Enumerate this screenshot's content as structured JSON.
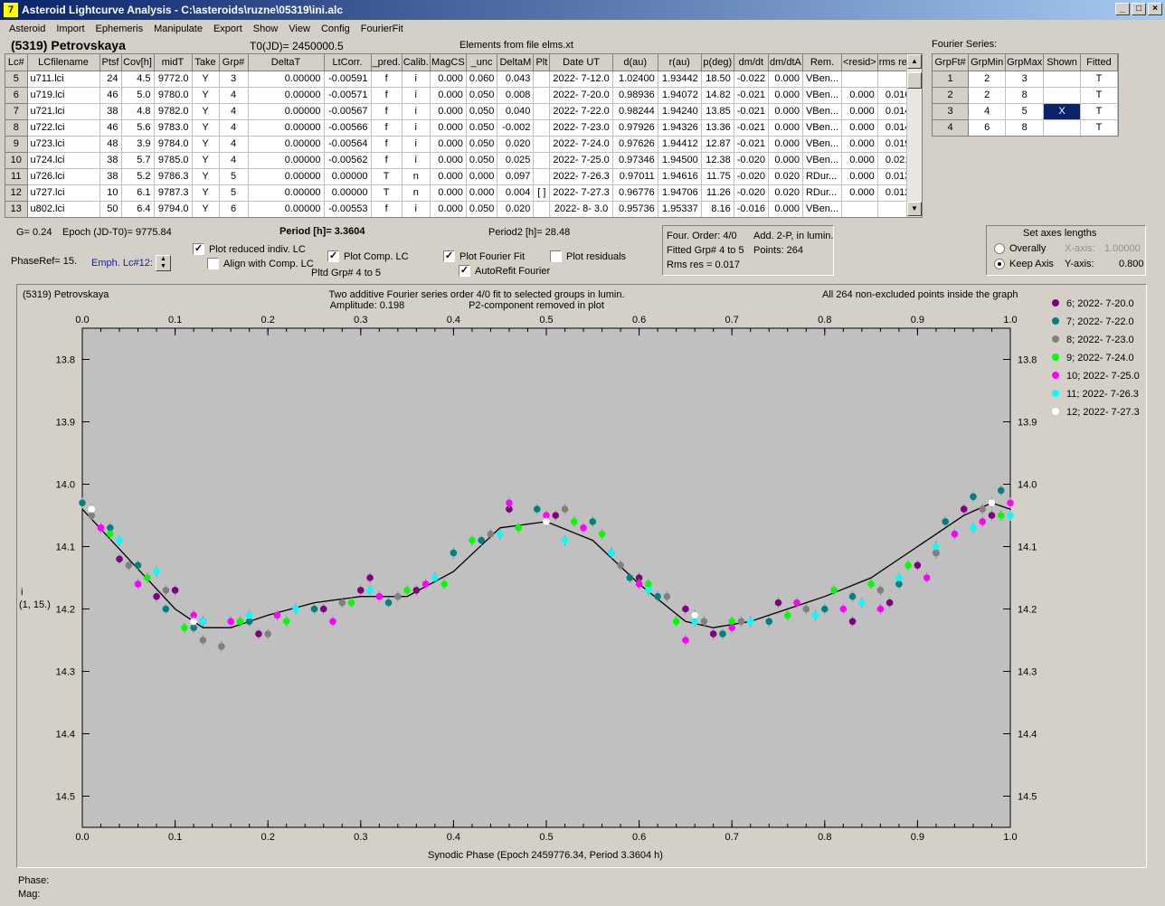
{
  "window": {
    "title": "Asteroid Lightcurve Analysis - C:\\asteroids\\ruzne\\05319\\ini.alc",
    "icon_label": "7"
  },
  "menu": [
    "Asteroid",
    "Import",
    "Ephemeris",
    "Manipulate",
    "Export",
    "Show",
    "View",
    "Config",
    "FourierFit"
  ],
  "header": {
    "asteroid": "(5319) Petrovskaya",
    "t0": "T0(JD)= 2450000.5",
    "elements": "Elements from file elms.xt",
    "fourier_series_label": "Fourier Series:"
  },
  "lc_table": {
    "columns": [
      "Lc#",
      "LCfilename",
      "Ptsf",
      "Cov[h]",
      "midT",
      "Take",
      "Grp#",
      "DeltaT",
      "LtCorr.",
      "_pred.",
      "Calib.",
      "MagCS",
      "_unc",
      "DeltaM",
      "Plt",
      "Date UT",
      "d(au)",
      "r(au)",
      "p(deg)",
      "dm/dt",
      "dm/dtA",
      "Rem.",
      "<resid>",
      "rms res"
    ],
    "rows": [
      [
        "5",
        "u711.lci",
        "24",
        "4.5",
        "9772.0",
        "Y",
        "3",
        "0.00000",
        "-0.00591",
        "f",
        "i",
        "0.000",
        "0.060",
        "0.043",
        "",
        "2022- 7-12.0",
        "1.02400",
        "1.93442",
        "18.50",
        "-0.022",
        "0.000",
        "VBen...",
        "",
        ""
      ],
      [
        "6",
        "u719.lci",
        "46",
        "5.0",
        "9780.0",
        "Y",
        "4",
        "0.00000",
        "-0.00571",
        "f",
        "i",
        "0.000",
        "0.050",
        "0.008",
        "",
        "2022- 7-20.0",
        "0.98936",
        "1.94072",
        "14.82",
        "-0.021",
        "0.000",
        "VBen...",
        "0.000",
        "0.016"
      ],
      [
        "7",
        "u721.lci",
        "38",
        "4.8",
        "9782.0",
        "Y",
        "4",
        "0.00000",
        "-0.00567",
        "f",
        "i",
        "0.000",
        "0.050",
        "0.040",
        "",
        "2022- 7-22.0",
        "0.98244",
        "1.94240",
        "13.85",
        "-0.021",
        "0.000",
        "VBen...",
        "0.000",
        "0.014"
      ],
      [
        "8",
        "u722.lci",
        "46",
        "5.6",
        "9783.0",
        "Y",
        "4",
        "0.00000",
        "-0.00566",
        "f",
        "i",
        "0.000",
        "0.050",
        "-0.002",
        "",
        "2022- 7-23.0",
        "0.97926",
        "1.94326",
        "13.36",
        "-0.021",
        "0.000",
        "VBen...",
        "0.000",
        "0.014"
      ],
      [
        "9",
        "u723.lci",
        "48",
        "3.9",
        "9784.0",
        "Y",
        "4",
        "0.00000",
        "-0.00564",
        "f",
        "i",
        "0.000",
        "0.050",
        "0.020",
        "",
        "2022- 7-24.0",
        "0.97626",
        "1.94412",
        "12.87",
        "-0.021",
        "0.000",
        "VBen...",
        "0.000",
        "0.019"
      ],
      [
        "10",
        "u724.lci",
        "38",
        "5.7",
        "9785.0",
        "Y",
        "4",
        "0.00000",
        "-0.00562",
        "f",
        "i",
        "0.000",
        "0.050",
        "0.025",
        "",
        "2022- 7-25.0",
        "0.97346",
        "1.94500",
        "12.38",
        "-0.020",
        "0.000",
        "VBen...",
        "0.000",
        "0.021"
      ],
      [
        "11",
        "u726.lci",
        "38",
        "5.2",
        "9786.3",
        "Y",
        "5",
        "0.00000",
        "0.00000",
        "T",
        "n",
        "0.000",
        "0.000",
        "0.097",
        "",
        "2022- 7-26.3",
        "0.97011",
        "1.94616",
        "11.75",
        "-0.020",
        "0.020",
        "RDur...",
        "0.000",
        "0.013"
      ],
      [
        "12",
        "u727.lci",
        "10",
        "6.1",
        "9787.3",
        "Y",
        "5",
        "0.00000",
        "0.00000",
        "T",
        "n",
        "0.000",
        "0.000",
        "0.004",
        "[ ]",
        "2022- 7-27.3",
        "0.96776",
        "1.94706",
        "11.26",
        "-0.020",
        "0.020",
        "RDur...",
        "0.000",
        "0.012"
      ],
      [
        "13",
        "u802.lci",
        "50",
        "6.4",
        "9794.0",
        "Y",
        "6",
        "0.00000",
        "-0.00553",
        "f",
        "i",
        "0.000",
        "0.050",
        "0.020",
        "",
        "2022- 8- 3.0",
        "0.95736",
        "1.95337",
        "8.16",
        "-0.016",
        "0.000",
        "VBen...",
        "",
        ""
      ]
    ]
  },
  "fourier_table": {
    "columns": [
      "GrpFt#",
      "GrpMin",
      "GrpMax",
      "Shown",
      "Fitted"
    ],
    "rows": [
      [
        "1",
        "2",
        "3",
        "",
        "T"
      ],
      [
        "2",
        "2",
        "8",
        "",
        "T"
      ],
      [
        "3",
        "4",
        "5",
        "X",
        "T"
      ],
      [
        "4",
        "6",
        "8",
        "",
        "T"
      ]
    ]
  },
  "controls": {
    "g": "G= 0.24",
    "epoch": "Epoch (JD-T0)= 9775.84",
    "period": "Period [h]= 3.3604",
    "period2": "Period2 [h]= 28.48",
    "phaseref": "PhaseRef= 15.",
    "emph": "Emph. Lc#12:",
    "plot_reduced": "Plot reduced indiv. LC",
    "align": "Align with Comp. LC",
    "plot_comp": "Plot Comp. LC",
    "pltd_grp": "Pltd Grp#  4  to   5",
    "plot_fourier": "Plot Fourier Fit",
    "autorefit": "AutoRefit Fourier",
    "plot_resid": "Plot residuals",
    "four_order": "Four. Order:  4/0",
    "add2p": "Add. 2-P, in lumin.",
    "fitted_grp": "Fitted Grp# 4 to 5",
    "points": "Points: 264",
    "rms": "Rms res     = 0.017",
    "axes_title": "Set axes lengths",
    "overally": "Overally",
    "keep_axis": "Keep Axis",
    "xaxis_label": "X-axis:",
    "xaxis_val": "1.00000",
    "yaxis_label": "Y-axis:",
    "yaxis_val": "0.800"
  },
  "plot": {
    "top_left": "(5319) Petrovskaya",
    "top_center1": "Two additive Fourier series order 4/0 fit to selected groups in lumin.",
    "top_center2a": "Amplitude: 0.198",
    "top_center2b": "P2-component removed in plot",
    "top_right": "All 264 non-excluded points inside the graph",
    "ylabel1": "i",
    "ylabel2": "(1, 15.)",
    "xlabel": "Synodic Phase (Epoch 2459776.34, Period 3.3604 h)",
    "x_ticks": [
      "0.0",
      "0.1",
      "0.2",
      "0.3",
      "0.4",
      "0.5",
      "0.6",
      "0.7",
      "0.8",
      "0.9",
      "1.0"
    ],
    "y_ticks": [
      "13.8",
      "13.9",
      "14.0",
      "14.1",
      "14.2",
      "14.3",
      "14.4",
      "14.5"
    ],
    "legend": [
      {
        "label": "6; 2022- 7-20.0",
        "color": "#800080"
      },
      {
        "label": "7; 2022- 7-22.0",
        "color": "#008080"
      },
      {
        "label": "8; 2022- 7-23.0",
        "color": "#808080"
      },
      {
        "label": "9; 2022- 7-24.0",
        "color": "#00ff00"
      },
      {
        "label": "10; 2022- 7-25.0",
        "color": "#ff00ff"
      },
      {
        "label": "11; 2022- 7-26.3",
        "color": "#00ffff"
      },
      {
        "label": "12; 2022- 7-27.3",
        "color": "#ffffff"
      }
    ]
  },
  "status": {
    "phase": "Phase:",
    "mag": "Mag:"
  },
  "chart_data": {
    "type": "scatter",
    "title": "Two additive Fourier series order 4/0 fit to selected groups in lumin.",
    "xlabel": "Synodic Phase (Epoch 2459776.34, Period 3.3604 h)",
    "ylabel": "i",
    "xlim": [
      0,
      1
    ],
    "ylim": [
      13.75,
      14.55
    ],
    "y_inverted": true,
    "fit_curve": {
      "x": [
        0,
        0.05,
        0.1,
        0.13,
        0.16,
        0.2,
        0.25,
        0.3,
        0.35,
        0.4,
        0.45,
        0.5,
        0.55,
        0.6,
        0.65,
        0.68,
        0.72,
        0.8,
        0.85,
        0.9,
        0.95,
        0.98,
        1.0
      ],
      "y": [
        14.04,
        14.12,
        14.2,
        14.23,
        14.23,
        14.21,
        14.19,
        14.18,
        14.18,
        14.14,
        14.07,
        14.06,
        14.09,
        14.16,
        14.22,
        14.23,
        14.22,
        14.18,
        14.15,
        14.1,
        14.05,
        14.03,
        14.04
      ]
    },
    "series": [
      {
        "name": "6; 2022- 7-20.0",
        "x": [
          0.02,
          0.04,
          0.08,
          0.1,
          0.13,
          0.19,
          0.26,
          0.3,
          0.31,
          0.36,
          0.46,
          0.51,
          0.57,
          0.6,
          0.65,
          0.68,
          0.75,
          0.83,
          0.87,
          0.9,
          0.92,
          0.95,
          0.98
        ],
        "y": [
          14.07,
          14.12,
          14.18,
          14.17,
          14.22,
          14.24,
          14.2,
          14.17,
          14.15,
          14.17,
          14.04,
          14.05,
          14.11,
          14.15,
          14.2,
          14.24,
          14.19,
          14.22,
          14.19,
          14.13,
          14.11,
          14.04,
          14.05
        ]
      },
      {
        "name": "7; 2022- 7-22.0",
        "x": [
          0.0,
          0.03,
          0.06,
          0.09,
          0.12,
          0.18,
          0.25,
          0.33,
          0.4,
          0.43,
          0.49,
          0.55,
          0.59,
          0.62,
          0.66,
          0.69,
          0.74,
          0.8,
          0.83,
          0.88,
          0.93,
          0.96,
          0.99
        ],
        "y": [
          14.03,
          14.07,
          14.13,
          14.2,
          14.23,
          14.22,
          14.2,
          14.19,
          14.11,
          14.09,
          14.04,
          14.06,
          14.15,
          14.18,
          14.21,
          14.24,
          14.22,
          14.2,
          14.18,
          14.16,
          14.06,
          14.02,
          14.01
        ]
      },
      {
        "name": "8; 2022- 7-23.0",
        "x": [
          0.01,
          0.05,
          0.09,
          0.13,
          0.15,
          0.2,
          0.28,
          0.34,
          0.44,
          0.52,
          0.58,
          0.63,
          0.67,
          0.71,
          0.78,
          0.86,
          0.92,
          0.97
        ],
        "y": [
          14.05,
          14.13,
          14.17,
          14.25,
          14.26,
          14.24,
          14.19,
          14.18,
          14.08,
          14.04,
          14.13,
          14.18,
          14.22,
          14.22,
          14.2,
          14.17,
          14.11,
          14.04
        ]
      },
      {
        "name": "9; 2022- 7-24.0",
        "x": [
          0.03,
          0.07,
          0.11,
          0.17,
          0.22,
          0.29,
          0.35,
          0.39,
          0.42,
          0.47,
          0.53,
          0.56,
          0.61,
          0.64,
          0.7,
          0.76,
          0.81,
          0.85,
          0.89,
          0.94,
          0.99
        ],
        "y": [
          14.08,
          14.15,
          14.23,
          14.22,
          14.22,
          14.19,
          14.17,
          14.16,
          14.09,
          14.07,
          14.06,
          14.08,
          14.16,
          14.22,
          14.22,
          14.21,
          14.17,
          14.16,
          14.13,
          14.08,
          14.05
        ]
      },
      {
        "name": "10; 2022- 7-25.0",
        "x": [
          0.02,
          0.06,
          0.12,
          0.16,
          0.21,
          0.27,
          0.32,
          0.37,
          0.46,
          0.5,
          0.54,
          0.6,
          0.65,
          0.7,
          0.77,
          0.82,
          0.86,
          0.91,
          0.94,
          0.97,
          1.0
        ],
        "y": [
          14.07,
          14.16,
          14.21,
          14.22,
          14.21,
          14.22,
          14.18,
          14.16,
          14.03,
          14.05,
          14.07,
          14.16,
          14.25,
          14.23,
          14.19,
          14.2,
          14.2,
          14.15,
          14.08,
          14.06,
          14.03
        ]
      },
      {
        "name": "11; 2022- 7-26.3",
        "x": [
          0.04,
          0.08,
          0.13,
          0.18,
          0.23,
          0.31,
          0.38,
          0.45,
          0.52,
          0.57,
          0.61,
          0.66,
          0.72,
          0.79,
          0.84,
          0.88,
          0.92,
          0.96,
          1.0
        ],
        "y": [
          14.09,
          14.14,
          14.22,
          14.21,
          14.2,
          14.17,
          14.15,
          14.08,
          14.09,
          14.11,
          14.17,
          14.22,
          14.22,
          14.21,
          14.19,
          14.15,
          14.1,
          14.07,
          14.05
        ]
      },
      {
        "name": "12; 2022- 7-27.3",
        "x": [
          0.01,
          0.12,
          0.5,
          0.66,
          0.98
        ],
        "y": [
          14.04,
          14.22,
          14.06,
          14.21,
          14.03
        ]
      }
    ]
  }
}
